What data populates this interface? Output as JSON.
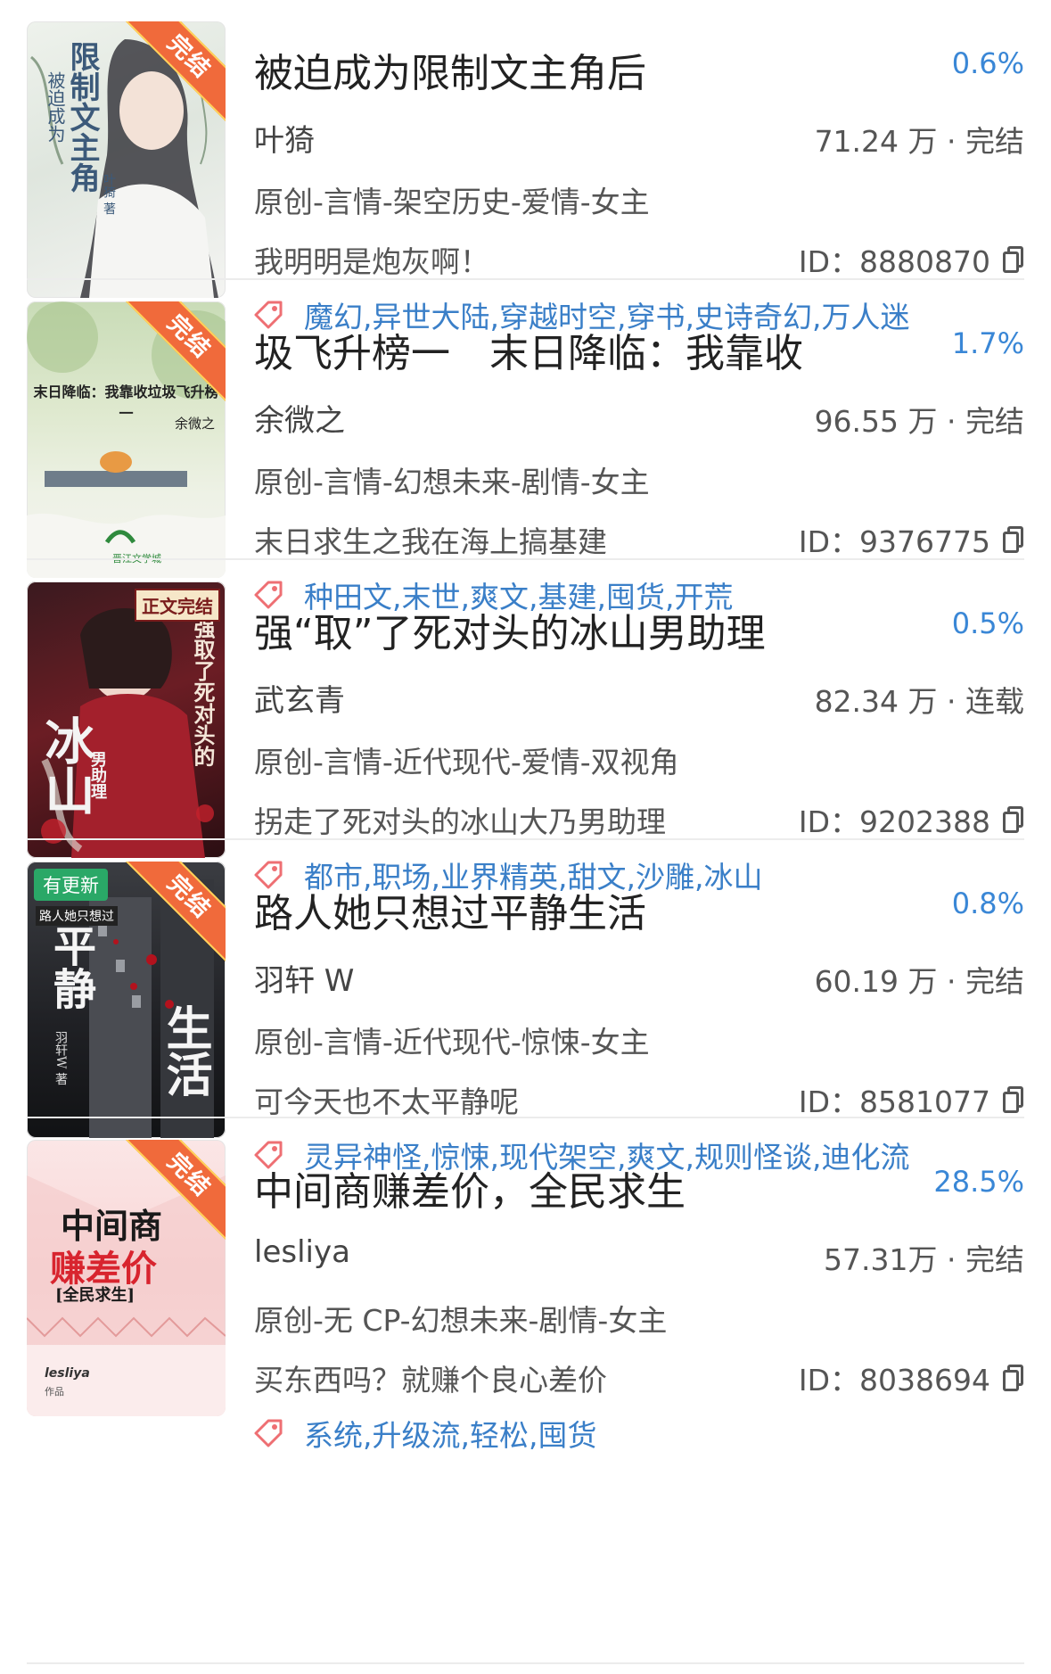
{
  "colors": {
    "accent": "#3a87d6",
    "tag_text": "#3a7fc8",
    "ribbon": "#f06a3b",
    "update_badge": "#2aa867"
  },
  "items": [
    {
      "title": "被迫成为限制文主角后",
      "percent": "0.6%",
      "author": "叶猗",
      "stats": "71.24 万 · 完结",
      "genre": "原创-言情-架空历史-爱情-女主",
      "blurb": "我明明是炮灰啊！",
      "id": "ID：8880870",
      "tags": "魔幻,异世大陆,穿越时空,穿书,史诗奇幻,万人迷",
      "cover_ribbon": "完结",
      "cover_title": "限制文主角",
      "cover_subtitle": "被迫成为",
      "cover_author": "叶猗 著"
    },
    {
      "title": "圾飞升榜一　末日降临：我靠收",
      "percent": "1.7%",
      "author": "余微之",
      "stats": "96.55 万 · 完结",
      "genre": "原创-言情-幻想未来-剧情-女主",
      "blurb": "末日求生之我在海上搞基建",
      "id": "ID：9376775",
      "tags": "种田文,末世,爽文,基建,囤货,开荒",
      "cover_ribbon": "完结",
      "cover_title": "末日降临：我靠收垃圾飞升榜一",
      "cover_author": "余微之",
      "cover_logo": "晋江文学城"
    },
    {
      "title": "强“取”了死对头的冰山男助理",
      "percent": "0.5%",
      "author": "武玄青",
      "stats": "82.34 万 · 连载",
      "genre": "原创-言情-近代现代-爱情-双视角",
      "blurb": "拐走了死对头的冰山大乃男助理",
      "id": "ID：9202388",
      "tags": "都市,职场,业界精英,甜文,沙雕,冰山",
      "cover_ribbon": "正文完结",
      "cover_title": "强取了死对头的",
      "cover_big": "冰山",
      "cover_sub": "男助理"
    },
    {
      "title": "路人她只想过平静生活",
      "percent": "0.8%",
      "author": "羽轩 W",
      "stats": "60.19 万 · 完结",
      "genre": "原创-言情-近代现代-惊悚-女主",
      "blurb": "可今天也不太平静呢",
      "id": "ID：8581077",
      "tags": "灵异神怪,惊悚,现代架空,爽文,规则怪谈,迪化流",
      "cover_ribbon": "完结",
      "cover_badge": "有更新",
      "cover_top": "路人她只想过",
      "cover_big1": "平静",
      "cover_big2": "生活",
      "cover_author": "羽轩W 著"
    },
    {
      "title": "中间商赚差价，全民求生",
      "percent": "28.5%",
      "author": "lesliya",
      "stats": "57.31万 · 完结",
      "genre": "原创-无 CP-幻想未来-剧情-女主",
      "blurb": "买东西吗？就赚个良心差价",
      "id": "ID：8038694",
      "tags": "系统,升级流,轻松,囤货",
      "cover_ribbon": "完结",
      "cover_line1": "中间商",
      "cover_line2": "赚差价",
      "cover_line3": "[全民求生]",
      "cover_author": "lesliya",
      "cover_author_sub": "作品"
    }
  ]
}
